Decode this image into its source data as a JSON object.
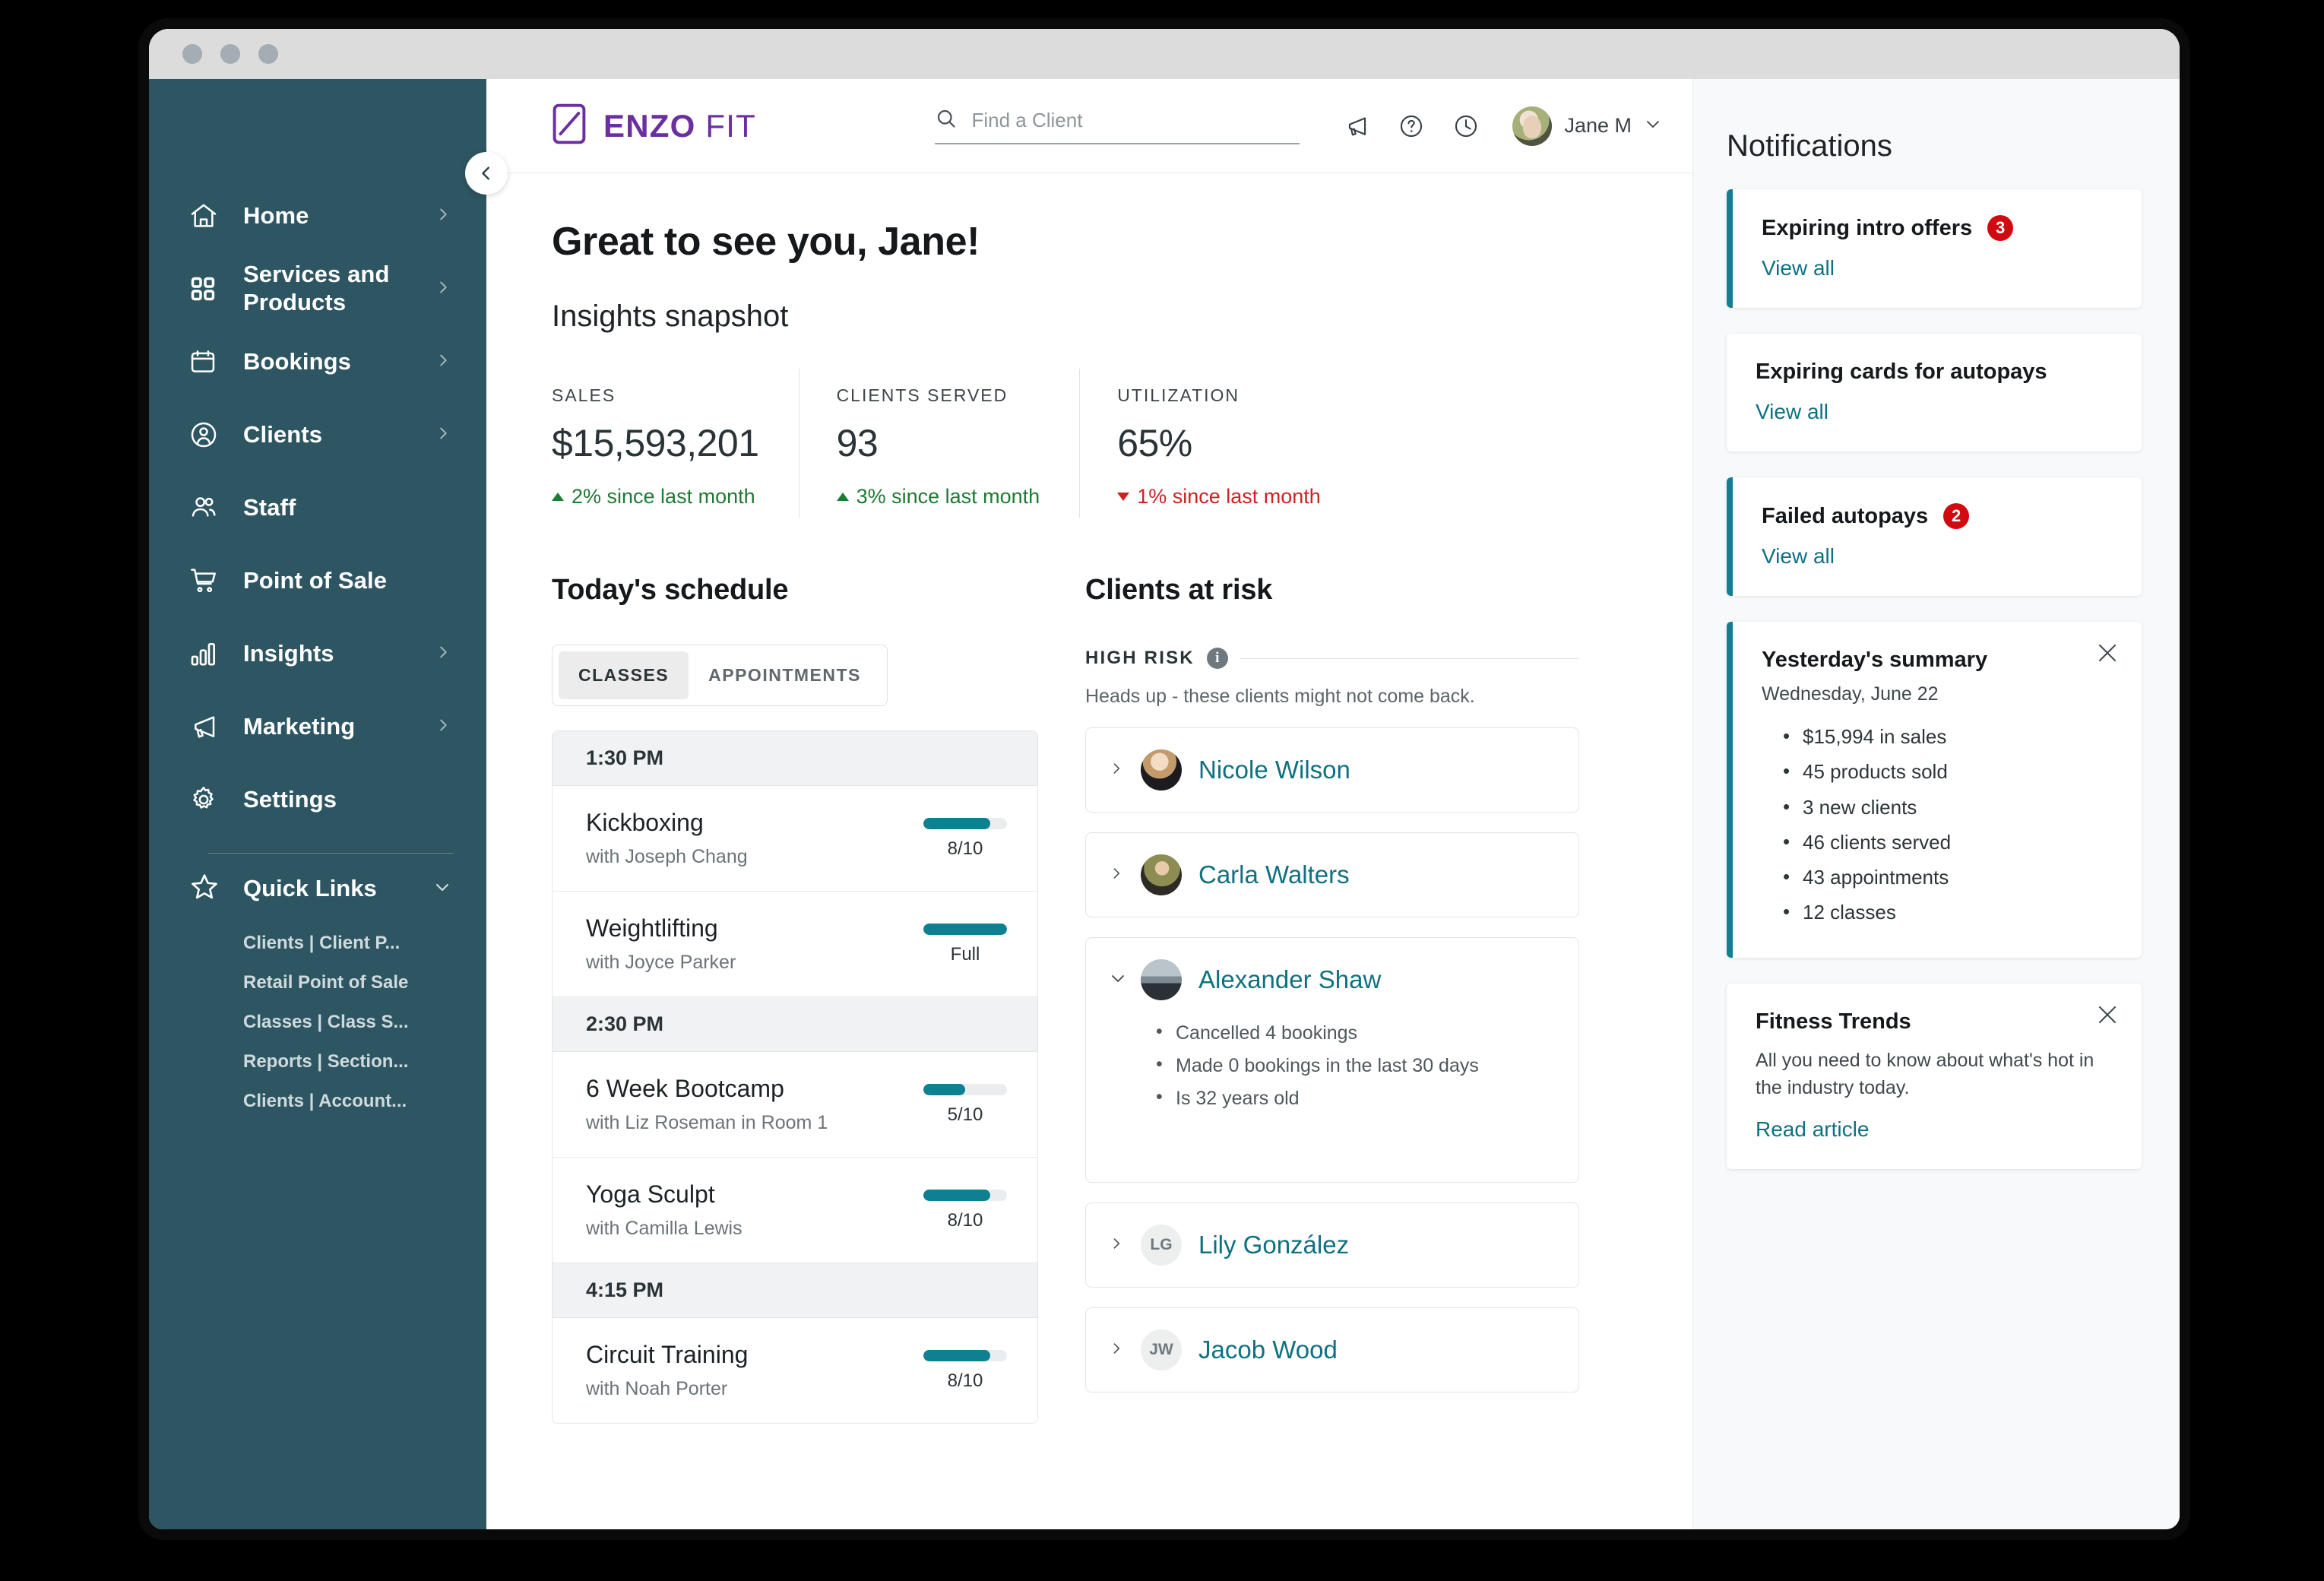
{
  "window": {
    "dots": 3
  },
  "brand": {
    "bold": "ENZO",
    "light": "FIT",
    "logo_icon": "enzo-logo-icon"
  },
  "search": {
    "placeholder": "Find a Client",
    "value": ""
  },
  "topbar": {
    "announcements_icon": "megaphone-icon",
    "help_icon": "question-circle-icon",
    "history_icon": "clock-icon",
    "user_name": "Jane M"
  },
  "sidebar": {
    "collapse_label": "collapse-sidebar",
    "items": [
      {
        "label": "Home",
        "icon": "home-icon",
        "chevron": true
      },
      {
        "label": "Services and Products",
        "icon": "grid-icon",
        "chevron": true
      },
      {
        "label": "Bookings",
        "icon": "calendar-icon",
        "chevron": true
      },
      {
        "label": "Clients",
        "icon": "client-circle-icon",
        "chevron": true
      },
      {
        "label": "Staff",
        "icon": "people-icon",
        "chevron": false
      },
      {
        "label": "Point of Sale",
        "icon": "cart-icon",
        "chevron": false
      },
      {
        "label": "Insights",
        "icon": "bar-chart-icon",
        "chevron": true
      },
      {
        "label": "Marketing",
        "icon": "megaphone-icon",
        "chevron": true
      },
      {
        "label": "Settings",
        "icon": "gear-icon",
        "chevron": false
      }
    ],
    "quick_links": {
      "title": "Quick Links",
      "icon": "star-icon",
      "items": [
        "Clients | Client P...",
        "Retail Point of Sale",
        "Classes | Class S...",
        "Reports | Section...",
        "Clients | Account..."
      ]
    }
  },
  "main": {
    "greeting": "Great to see you, Jane!",
    "insights_title": "Insights snapshot",
    "metrics": [
      {
        "label": "SALES",
        "value": "$15,593,201",
        "delta": "2% since last month",
        "direction": "up"
      },
      {
        "label": "CLIENTS SERVED",
        "value": "93",
        "delta": "3% since last month",
        "direction": "up"
      },
      {
        "label": "UTILIZATION",
        "value": "65%",
        "delta": "1% since last month",
        "direction": "down"
      }
    ],
    "schedule": {
      "title": "Today's schedule",
      "tabs": [
        {
          "label": "CLASSES",
          "active": true
        },
        {
          "label": "APPOINTMENTS",
          "active": false
        }
      ],
      "groups": [
        {
          "time": "1:30 PM",
          "classes": [
            {
              "name": "Kickboxing",
              "with": "with Joseph Chang",
              "capacity": "8/10",
              "fill_pct": 80
            },
            {
              "name": "Weightlifting",
              "with": "with Joyce Parker",
              "capacity": "Full",
              "fill_pct": 100
            }
          ]
        },
        {
          "time": "2:30 PM",
          "classes": [
            {
              "name": "6 Week Bootcamp",
              "with": "with Liz Roseman in Room 1",
              "capacity": "5/10",
              "fill_pct": 50
            },
            {
              "name": "Yoga Sculpt",
              "with": "with Camilla Lewis",
              "capacity": "8/10",
              "fill_pct": 80
            }
          ]
        },
        {
          "time": "4:15 PM",
          "classes": [
            {
              "name": "Circuit Training",
              "with": "with Noah Porter",
              "capacity": "8/10",
              "fill_pct": 80
            }
          ]
        }
      ]
    },
    "risk": {
      "title": "Clients at risk",
      "section_label": "HIGH RISK",
      "info_icon": "info-icon",
      "subtitle": "Heads up - these clients might not come back.",
      "clients": [
        {
          "name": "Nicole Wilson",
          "expanded": false,
          "avatar_type": "photo",
          "initials": ""
        },
        {
          "name": "Carla Walters",
          "expanded": false,
          "avatar_type": "photo",
          "initials": ""
        },
        {
          "name": "Alexander Shaw",
          "expanded": true,
          "avatar_type": "photo",
          "initials": "",
          "details": [
            "Cancelled 4 bookings",
            "Made 0 bookings in the last 30 days",
            "Is 32 years old"
          ]
        },
        {
          "name": "Lily González",
          "expanded": false,
          "avatar_type": "initials",
          "initials": "LG"
        },
        {
          "name": "Jacob Wood",
          "expanded": false,
          "avatar_type": "initials",
          "initials": "JW"
        }
      ]
    }
  },
  "notifications": {
    "title": "Notifications",
    "cards": [
      {
        "type": "link",
        "accent": true,
        "label": "Expiring intro offers",
        "badge": "3",
        "link": "View all"
      },
      {
        "type": "link",
        "accent": false,
        "label": "Expiring cards for autopays",
        "badge": "",
        "link": "View all"
      },
      {
        "type": "link",
        "accent": true,
        "label": "Failed autopays",
        "badge": "2",
        "link": "View all"
      },
      {
        "type": "summary",
        "accent": true,
        "closable": true,
        "label": "Yesterday's summary",
        "date": "Wednesday, June 22",
        "items": [
          "$15,994 in sales",
          "45 products sold",
          "3 new clients",
          "46 clients served",
          "43 appointments",
          "12 classes"
        ]
      },
      {
        "type": "article",
        "accent": false,
        "closable": true,
        "label": "Fitness Trends",
        "body": "All you need to know about what's hot in the industry today.",
        "link": "Read article"
      }
    ]
  },
  "colors": {
    "sidebar_bg": "#2d5662",
    "teal": "#0f7f92",
    "teal_text": "#0f7180",
    "brand_purple": "#6b2fa0",
    "badge_red": "#d10a10",
    "up_green": "#1f7a33",
    "down_red": "#cc2222",
    "notif_bg": "#f7f9fa"
  }
}
